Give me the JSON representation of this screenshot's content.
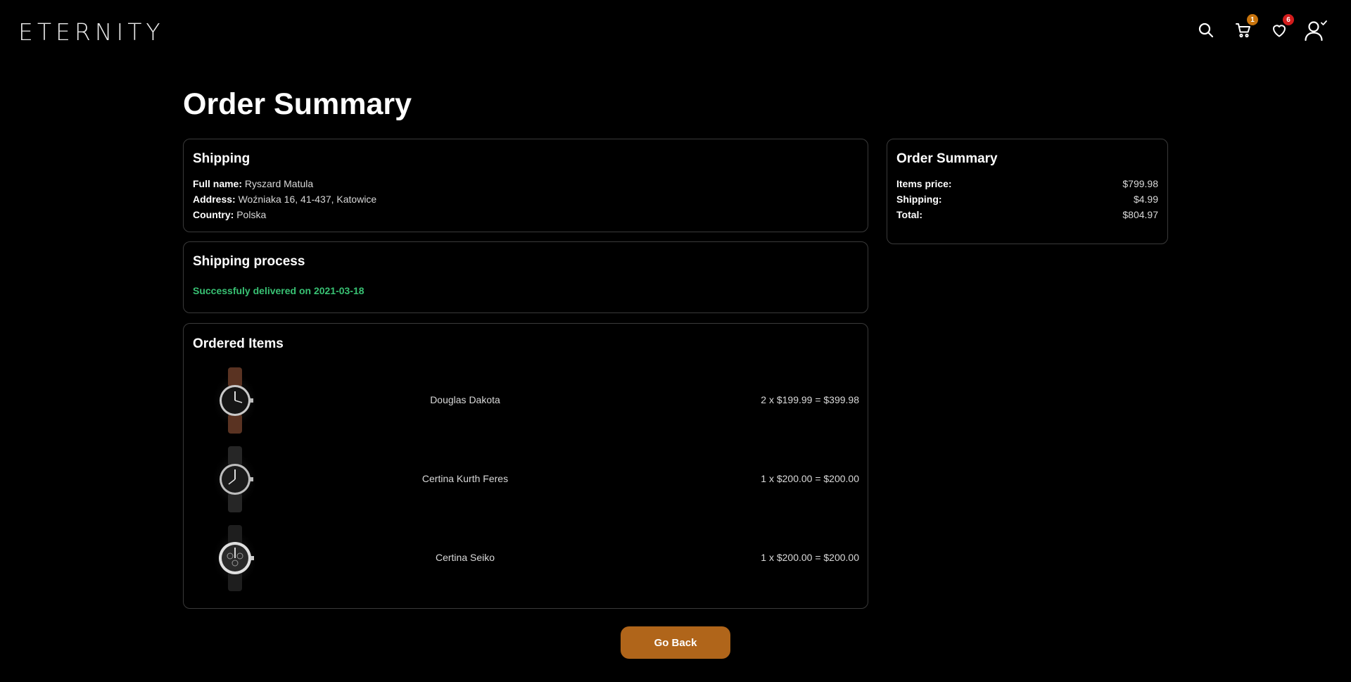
{
  "header": {
    "logo": "ETERNITY",
    "cart_badge": "1",
    "wishlist_badge": "6",
    "badge_colors": {
      "cart": "#c8740d",
      "wishlist": "#d31c1c"
    },
    "icons": [
      "search-icon",
      "cart-icon",
      "heart-icon",
      "user-check-icon"
    ]
  },
  "page_title": "Order Summary",
  "shipping": {
    "title": "Shipping",
    "full_name_label": "Full name:",
    "full_name": "Ryszard Matula",
    "address_label": "Address:",
    "address": "Woźniaka 16, 41-437, Katowice",
    "country_label": "Country:",
    "country": "Polska"
  },
  "shipping_process": {
    "title": "Shipping process",
    "status": "Successfuly delivered on 2021-03-18",
    "status_color": "#38c173"
  },
  "ordered_items": {
    "title": "Ordered Items",
    "items": [
      {
        "name": "Douglas Dakota",
        "price_line": "2 x $199.99 = $399.98",
        "strap": "#5a3322"
      },
      {
        "name": "Certina Kurth Feres",
        "price_line": "1 x $200.00 = $200.00",
        "strap": "#1e1e1e"
      },
      {
        "name": "Certina Seiko",
        "price_line": "1 x $200.00 = $200.00",
        "strap": "#1a1a1a"
      }
    ]
  },
  "order_summary": {
    "title": "Order Summary",
    "items_price_label": "Items price:",
    "items_price": "$799.98",
    "shipping_label": "Shipping:",
    "shipping": "$4.99",
    "total_label": "Total:",
    "total": "$804.97"
  },
  "actions": {
    "go_back": "Go Back",
    "accent": "#b0651a"
  }
}
